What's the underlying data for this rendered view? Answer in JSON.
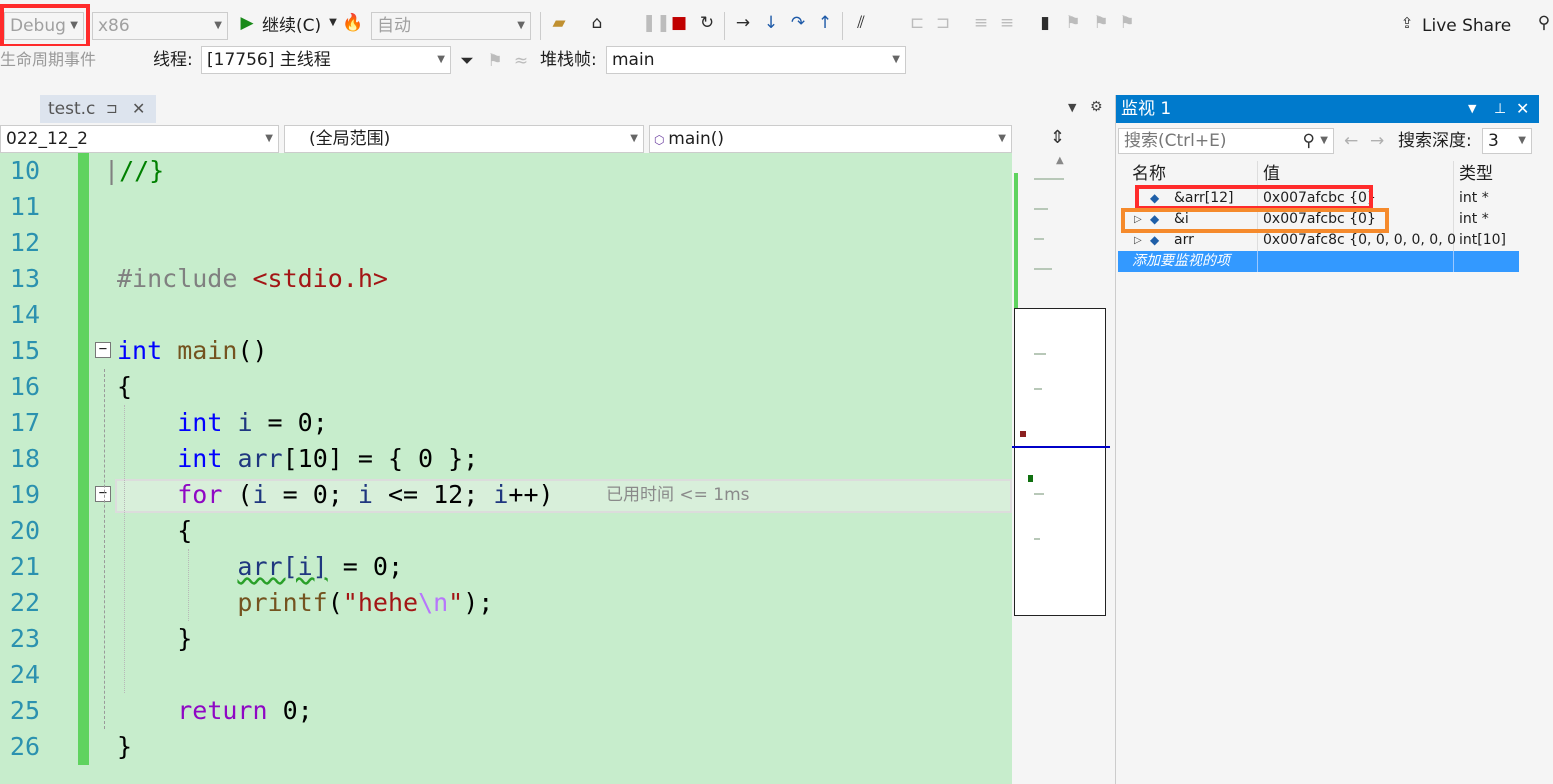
{
  "toolbar": {
    "config": "Debug",
    "platform": "x86",
    "continue_label": "继续(C)",
    "auto_label": "自动",
    "live_share": "Live Share"
  },
  "debugbar": {
    "lifecycle_label": "生命周期事件",
    "thread_label": "线程:",
    "thread_value": "[17756] 主线程",
    "stackframe_label": "堆栈帧:",
    "stackframe_value": "main"
  },
  "tab": {
    "name": "test.c",
    "pin": "⊐",
    "close": "✕"
  },
  "nav": {
    "project": "022_12_2",
    "scope": "(全局范围)",
    "function": "main()"
  },
  "editor": {
    "line_numbers": [
      "10",
      "11",
      "12",
      "13",
      "14",
      "15",
      "16",
      "17",
      "18",
      "19",
      "20",
      "21",
      "22",
      "23",
      "24",
      "25",
      "26"
    ],
    "perf_tip": "已用时间 <= 1ms"
  },
  "watch": {
    "title": "监视 1",
    "search_placeholder": "搜索(Ctrl+E)",
    "depth_label": "搜索深度:",
    "depth_value": "3",
    "columns": {
      "name": "名称",
      "value": "值",
      "type": "类型"
    },
    "rows": [
      {
        "name": "&arr[12]",
        "value": "0x007afcbc {0}",
        "type": "int *"
      },
      {
        "name": "&i",
        "value": "0x007afcbc {0}",
        "type": "int *"
      },
      {
        "name": "arr",
        "value": "0x007afc8c {0, 0, 0, 0, 0, 0, 0...",
        "type": "int[10]"
      }
    ],
    "add_item": "添加要监视的项"
  },
  "colors": {
    "editor_bg": "#c7edcc",
    "accent": "#007acc",
    "highlight_red": "#ff2b2b",
    "highlight_orange": "#f58a2c"
  }
}
